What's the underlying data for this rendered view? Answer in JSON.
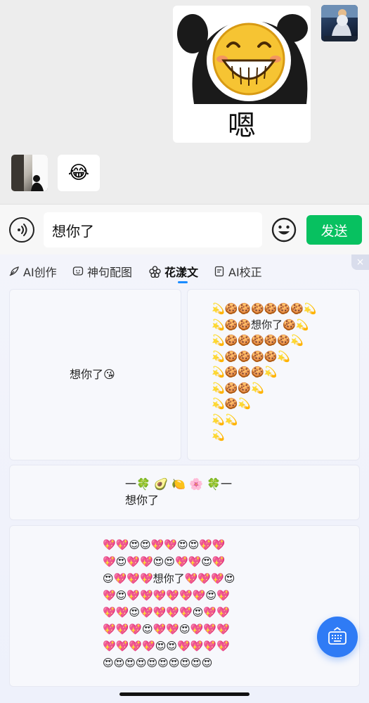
{
  "chat": {
    "sticker_caption": "嗯",
    "received_bubble_emoji": "😂"
  },
  "input_bar": {
    "input_value": "想你了",
    "send_label": "发送"
  },
  "panel": {
    "tabs": [
      {
        "label": "AI创作",
        "icon": "feather-icon"
      },
      {
        "label": "神句配图",
        "icon": "image-chat-icon"
      },
      {
        "label": "花漾文",
        "icon": "flower-icon",
        "active": true
      },
      {
        "label": "AI校正",
        "icon": "doc-check-icon"
      }
    ],
    "close_label": "×",
    "cards": [
      {
        "text": "想你了😘"
      },
      {
        "text": "💫🍪🍪🍪🍪🍪🍪💫\n💫🍪🍪想你了🍪💫\n💫🍪🍪🍪🍪🍪💫\n💫🍪🍪🍪🍪💫\n💫🍪🍪🍪💫\n💫🍪🍪💫\n💫🍪💫\n💫💫\n💫"
      },
      {
        "text": "一🍀 🥑 🍋 🌸 🍀一\n想你了"
      },
      {
        "text": "💖💖😍😍💖💖😍😍💖💖\n💖😍💖💖😍😍💖💖😍💖\n😍💖💖💖想你了💖💖💖😍\n💖😍💖💖💖💖💖💖😍💖\n💖💖😍💖💖💖💖😍💖💖\n💖💖💖😍💖💖😍💖💖💖\n💖💖💖💖😍😍💖💖💖💖\n😍😍😍😍😍😍😍😍😍😍"
      }
    ]
  },
  "colors": {
    "send_green": "#07c160",
    "accent_blue": "#2f7bf5",
    "tab_underline": "#1a8cff"
  }
}
